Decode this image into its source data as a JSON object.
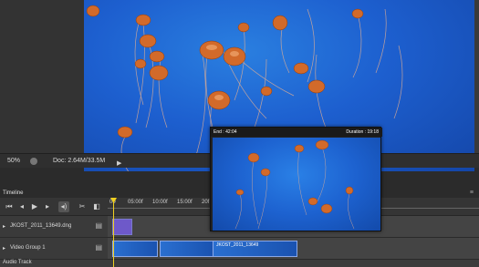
{
  "statusbar": {
    "zoom": "50%",
    "doc_size": "Doc: 2.64M/33.5M",
    "arrow_icon": "▶"
  },
  "timeline": {
    "title": "Timeline",
    "ruler_ticks": [
      "00",
      "05:00f",
      "10:00f",
      "15:00f",
      "20f"
    ],
    "tracks": [
      {
        "name": "JKOST_2011_13649.dng"
      },
      {
        "name": "Video Group 1"
      }
    ],
    "audio_track": "Audio Track",
    "clips": {
      "video_clip_label": "JKOST_2011_13649"
    }
  },
  "preview": {
    "end_label": "End : 42:04",
    "duration_label": "Duration : 19:18"
  },
  "colors": {
    "water": "#1d5fcf",
    "jellyfish": "#d46a2a",
    "playhead": "#f0d020",
    "clip_purple": "#6e59c9"
  }
}
